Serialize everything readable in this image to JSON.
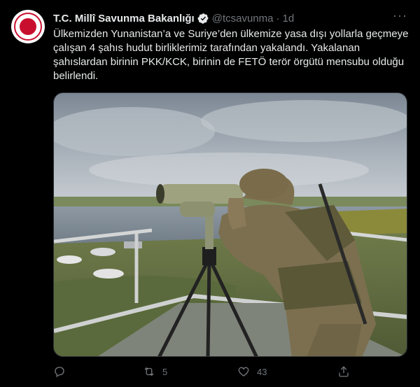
{
  "tweet": {
    "author_name": "T.C. Millî Savunma Bakanlığı",
    "handle": "@tcsavunma",
    "separator": "·",
    "time": "1d",
    "more_label": "···",
    "text_lines": [
      "Ülkemizden Yunanistan’a ve Suriye’den ülkemize yasa dışı yollarla geçmeye",
      "çalışan 4 şahıs hudut birliklerimiz tarafından yakalandı. Yakalanan",
      "şahıslardan birinin PKK/KCK, birinin de FETÖ terör örgütü mensubu olduğu",
      "belirlendi."
    ]
  },
  "actions": {
    "reply_count": "",
    "retweet_count": "5",
    "like_count": "43",
    "share_count": ""
  },
  "icons": {
    "avatar": "ministry-emblem-icon",
    "verified": "verified-badge-icon",
    "reply": "reply-icon",
    "retweet": "retweet-icon",
    "like": "heart-icon",
    "share": "share-icon"
  },
  "colors": {
    "background": "#000000",
    "text": "#e7e9ea",
    "secondary": "#71767b",
    "emblem_red": "#c8102e"
  }
}
